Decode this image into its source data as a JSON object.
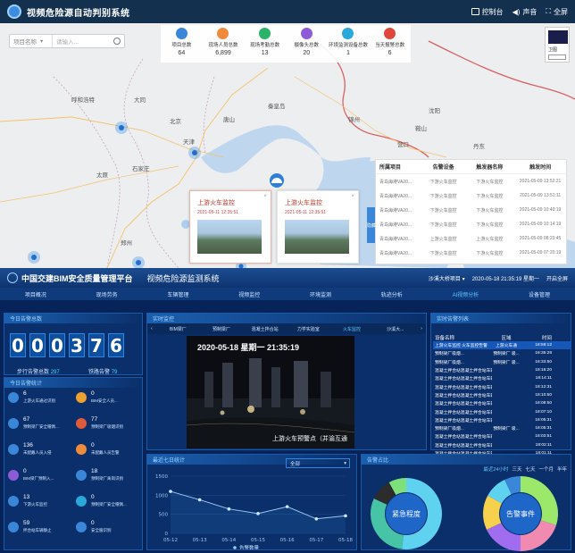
{
  "top": {
    "title": "视频危险源自动判别系统",
    "header_items": [
      {
        "label": "控制台",
        "icon": "monitor-icon"
      },
      {
        "label": "声音",
        "icon": "speaker-icon"
      },
      {
        "label": "全屏",
        "icon": "fullscreen-icon"
      }
    ],
    "search": {
      "select_value": "项目名称",
      "placeholder": "请输入..."
    },
    "stats": [
      {
        "label": "项目总数",
        "value": "64",
        "color": "#3a86d8"
      },
      {
        "label": "现场人员总数",
        "value": "6,899",
        "color": "#f08a3c"
      },
      {
        "label": "现场考勤总数",
        "value": "13",
        "color": "#2bb36a"
      },
      {
        "label": "摄像头总数",
        "value": "20",
        "color": "#8e5bd8"
      },
      {
        "label": "环境监测设备总数",
        "value": "1",
        "color": "#2aa8d8"
      },
      {
        "label": "当天报警总数",
        "value": "6",
        "color": "#e0473c"
      }
    ],
    "minimap": {
      "label": "卫图"
    },
    "map_labels": [
      "北京",
      "天津",
      "石家庄",
      "太原",
      "郑州",
      "沈阳",
      "呼和浩特",
      "大同",
      "唐山",
      "秦皇岛",
      "锦州",
      "营口",
      "鞍山",
      "丹东",
      "济南"
    ],
    "popups": [
      {
        "title": "上游火车监控",
        "date": "2021-05-11 12:35:51"
      },
      {
        "title": "上游火车监控",
        "date": "2021-05-11 12:35:51"
      }
    ],
    "table_tab": "隐藏",
    "table": {
      "headers": [
        "所属项目",
        "告警设备",
        "触发器名称",
        "触发时间"
      ],
      "rows": [
        [
          "青岛海港VA20...",
          "下游火车监控",
          "下游火车监控",
          "2021-05-09 13:52:21"
        ],
        [
          "青岛海港VA20...",
          "下游火车监控",
          "下游火车监控",
          "2021-05-09 13:51:11"
        ],
        [
          "青岛海港VA20...",
          "下游火车监控",
          "下游火车监控",
          "2021-05-09 10:49:19"
        ],
        [
          "青岛海港VA20...",
          "下游火车监控",
          "下游火车监控",
          "2021-05-09 10:14:19"
        ],
        [
          "青岛海港VA20...",
          "上游火车监控",
          "上游火车监控",
          "2021-05-09 08:23:45"
        ],
        [
          "青岛海港VA20...",
          "下游火车监控",
          "下游火车监控",
          "2021-05-09 07:20:19"
        ]
      ]
    }
  },
  "bottom": {
    "platform_title": "中国交建BIM安全质量管理平台",
    "system_title": "视频危险源监测系统",
    "header_right": [
      "沙溪大桥项目 ▾",
      "2020-05-18 21:35:19 星期一",
      "开启全屏"
    ],
    "nav": [
      "项目概况",
      "现场劳务",
      "车辆管理",
      "视频监控",
      "环境监测",
      "轨迹分析",
      "AI视频分析",
      "设备管理"
    ],
    "nav_active_index": 6,
    "today_total": {
      "title": "今日告警总数",
      "digits": [
        "0",
        "0",
        "0",
        "3",
        "7",
        "6"
      ],
      "sub": [
        {
          "label": "步行告警总数",
          "value": "297"
        },
        {
          "label": "铁路告警",
          "value": "79"
        }
      ]
    },
    "today_stats": {
      "title": "今日告警统计",
      "items": [
        {
          "value": "6",
          "label": "上游火车通过识别",
          "color": "#3a86d8"
        },
        {
          "value": "0",
          "label": "BIM安全人员...",
          "color": "#f0a030"
        },
        {
          "value": "67",
          "label": "预制梁厂安全帽佩...",
          "color": "#3a86d8"
        },
        {
          "value": "77",
          "label": "预制梁厂吸烟识别",
          "color": "#e05a3c"
        },
        {
          "value": "136",
          "label": "未配戴人员入侵",
          "color": "#3a86d8"
        },
        {
          "value": "0",
          "label": "未配戴人员告警",
          "color": "#f08a3c"
        },
        {
          "value": "0",
          "label": "BIM梁厂预制入...",
          "color": "#8e5bd8"
        },
        {
          "value": "18",
          "label": "预制梁厂离岗识别",
          "color": "#3a86d8"
        },
        {
          "value": "13",
          "label": "下游火车监控",
          "color": "#3a86d8"
        },
        {
          "value": "0",
          "label": "预制梁厂安全帽佩...",
          "color": "#2aa8d8"
        },
        {
          "value": "59",
          "label": "拌合站车辆静止",
          "color": "#3a86d8"
        },
        {
          "value": "0",
          "label": "安全服识别",
          "color": "#3a86d8"
        }
      ]
    },
    "video": {
      "title": "实时监控",
      "tabs": [
        "BIM梁厂",
        "预制梁厂",
        "混凝土拌合站",
        "力学实验室",
        "火车监控",
        "沙溪大..."
      ],
      "timestamp": "2020-05-18 星期一 21:35:19",
      "caption": "上游火车预警点（并渝互通"
    },
    "trend": {
      "title": "最近七日统计",
      "select": "全部",
      "legend": "告警数量"
    },
    "ratio": {
      "title": "告警占比",
      "periods": [
        "最近24小时",
        "三天",
        "七天",
        "一个月",
        "半年"
      ],
      "donut1_label": "紧急程度",
      "donut2_label": "告警事件"
    },
    "realtime": {
      "title": "实时告警列表",
      "headers": [
        "设备名称",
        "区域",
        "时间"
      ],
      "rows": [
        [
          "上游火车监控 火车监控告警",
          "上游火车通",
          "18:59:12"
        ],
        [
          "预制梁厂吸烟...",
          "预制梁厂 吸...",
          "18:35:29"
        ],
        [
          "预制梁厂吸烟...",
          "预制梁厂 吸...",
          "18:33:50"
        ],
        [
          "混凝土拌合站混凝土拌合站车辆...",
          "",
          "18:16:20"
        ],
        [
          "混凝土拌合站混凝土拌合站车辆...",
          "",
          "18:14:11"
        ],
        [
          "混凝土拌合站混凝土拌合站车辆...",
          "",
          "18:12:31"
        ],
        [
          "混凝土拌合站混凝土拌合站车辆...",
          "",
          "18:10:50"
        ],
        [
          "混凝土拌合站混凝土拌合站车辆...",
          "",
          "18:08:50"
        ],
        [
          "混凝土拌合站混凝土拌合站车辆...",
          "",
          "18:07:10"
        ],
        [
          "混凝土拌合站混凝土拌合站车辆...",
          "",
          "18:05:31"
        ],
        [
          "预制梁厂吸烟...",
          "预制梁厂 吸...",
          "18:05:31"
        ],
        [
          "混凝土拌合站混凝土拌合站车辆...",
          "",
          "18:03:51"
        ],
        [
          "混凝土拌合站混凝土拌合站车辆...",
          "",
          "18:02:11"
        ],
        [
          "混凝土拌合站混凝土拌合站车辆...",
          "",
          "18:01:11"
        ],
        [
          "混凝土拌合站混凝土拌合站车辆...",
          "",
          "18:00:31"
        ]
      ]
    }
  },
  "chart_data": [
    {
      "type": "line",
      "title": "最近七日统计",
      "x": [
        "05-12",
        "05-13",
        "05-14",
        "05-15",
        "05-16",
        "05-17",
        "05-18"
      ],
      "series": [
        {
          "name": "告警数量",
          "values": [
            1100,
            880,
            640,
            520,
            700,
            380,
            460
          ]
        }
      ],
      "ylim": [
        0,
        1500
      ],
      "yticks": [
        0,
        500,
        1000,
        1500
      ]
    },
    {
      "type": "pie",
      "title": "紧急程度",
      "labels": [
        "紧急程度"
      ],
      "values": [
        0.52,
        0.3,
        0.1,
        0.08
      ],
      "colors": [
        "#5fd2f0",
        "#47c3a6",
        "#2c2c2c",
        "#7ee07a"
      ]
    },
    {
      "type": "pie",
      "title": "告警事件",
      "labels": [
        "告警事件"
      ],
      "values": [
        0.3,
        0.2,
        0.18,
        0.15,
        0.1,
        0.07
      ],
      "colors": [
        "#9be86a",
        "#f08ab0",
        "#a06cf0",
        "#f7d04c",
        "#5fd2f0",
        "#3a86d8"
      ]
    }
  ]
}
